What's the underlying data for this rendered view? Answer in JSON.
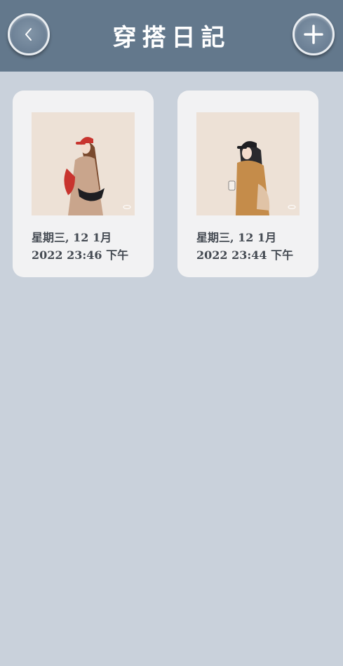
{
  "header": {
    "title": "穿搭日記",
    "back_icon": "chevron-left-icon",
    "add_icon": "plus-icon",
    "background": "#63788c"
  },
  "entries": [
    {
      "date_line1": "星期三, 12 1月",
      "date_line2": "2022 23:46 下午",
      "image": "outfit-illustration-red-cap"
    },
    {
      "date_line1": "星期三, 12 1月",
      "date_line2": "2022 23:44 下午",
      "image": "outfit-illustration-black-cap"
    }
  ],
  "colors": {
    "page_background": "#c9d1db",
    "card_background": "#f2f2f3",
    "text": "#444a52"
  }
}
